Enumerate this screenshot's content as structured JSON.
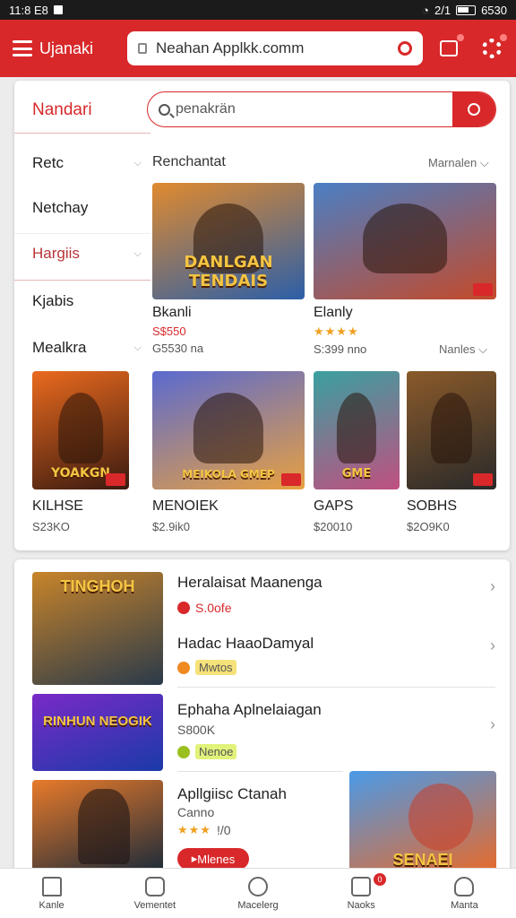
{
  "status_bar": {
    "left": "11:8 E8",
    "right": "2/1",
    "battery_text": "6530"
  },
  "app": {
    "title": "Ujanaki",
    "url": "Neahan Applkk.comm"
  },
  "colors": {
    "brand": "#d8282a",
    "stars": "#f0a020"
  },
  "sidebar": {
    "header": "Nandari",
    "items": [
      {
        "label": "Retc"
      },
      {
        "label": "Netchay"
      },
      {
        "label": "Hargiis"
      },
      {
        "label": "Kjabis"
      },
      {
        "label": "Mealkra"
      }
    ]
  },
  "search": {
    "placeholder": "penakrän"
  },
  "section1": {
    "title": "Renchantat",
    "more": "Marnalen"
  },
  "featured": [
    {
      "name": "Bkanli",
      "price": "S$550",
      "meta": "G5530 na",
      "caption": "DANLGAN TENDAIS",
      "c1": "#e08a2e",
      "c2": "#2c5fa8"
    },
    {
      "name": "Elanly",
      "stars": "★★★★",
      "meta": "S:399 nno",
      "caption": "",
      "c1": "#4a7fc5",
      "c2": "#c44a2a"
    }
  ],
  "section2": {
    "more": "Nanles"
  },
  "games": [
    {
      "name": "KILHSE",
      "price": "S23KO",
      "caption": "YOAKGN",
      "c1": "#ea6a1e",
      "c2": "#3a1a10"
    },
    {
      "name": "MENOIEK",
      "price": "$2.9ik0",
      "caption": "MEIKOLA GMEP",
      "c1": "#5a6ad0",
      "c2": "#e8a040"
    },
    {
      "name": "GAPS",
      "price": "$20010",
      "caption": "GME",
      "c1": "#3aa0a0",
      "c2": "#c05080"
    },
    {
      "name": "SOBHS",
      "price": "$2O9K0",
      "caption": "",
      "c1": "#8a5a2a",
      "c2": "#2a2a2a"
    }
  ],
  "list": [
    {
      "title": "Heralaisat Maanenga",
      "sub": "S.0ofe",
      "chip_color": "#d8282a",
      "caption": "TINGHOH",
      "c1": "#c8842a",
      "c2": "#2a3a4a"
    },
    {
      "title": "Hadac HaaoDamyal",
      "sub": "Mwtos",
      "chip_color": "#f08a20"
    },
    {
      "title": "Ephaha Aplnelaiagan",
      "price": "S800K",
      "sub": "Nenoe",
      "chip_color": "#9ac020",
      "caption": "RINHUN NEOGIK",
      "c1": "#7a2ac8",
      "c2": "#1a3aa8"
    },
    {
      "title": "Apllgiisc Ctanah",
      "price": "Canno",
      "stars": "★★★",
      "rating": "!/0",
      "caption": "",
      "c1": "#e87a2a",
      "c2": "#1a2a3a"
    }
  ],
  "promo": {
    "caption": "SENAEI",
    "c1": "#4a9ae8",
    "c2": "#e86a2a",
    "button": "Mlenes"
  },
  "bottom_nav": [
    {
      "label": "Kanle",
      "icon": "home-icon"
    },
    {
      "label": "Vementet",
      "icon": "chat-icon"
    },
    {
      "label": "Macelerg",
      "icon": "circle-icon"
    },
    {
      "label": "Naoks",
      "icon": "bag-icon",
      "badge": "0"
    },
    {
      "label": "Manta",
      "icon": "user-icon"
    }
  ]
}
